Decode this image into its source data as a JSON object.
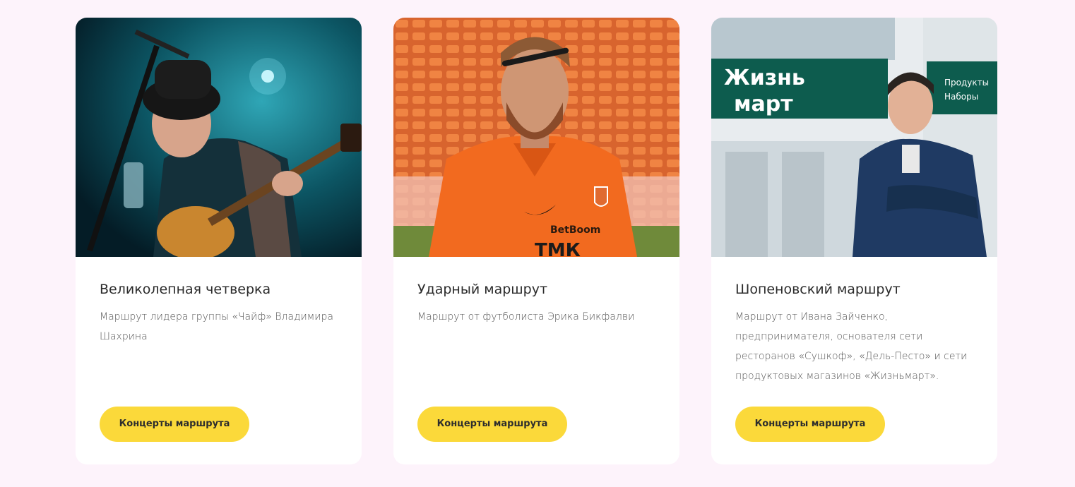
{
  "colors": {
    "page_background": "#fdf3fb",
    "card_background": "#ffffff",
    "button_background": "#fbd93a"
  },
  "cards": [
    {
      "title": "Великолепная четверка",
      "description": "Маршрут лидера группы «Чайф» Владимира Шахрина",
      "button_label": "Концерты маршрута",
      "photo_alt": "Musician with hat playing guitar on stage"
    },
    {
      "title": "Ударный маршрут",
      "description": "Маршрут от футболиста Эрика Бикфалви",
      "button_label": "Концерты маршрута",
      "photo_alt": "Football player in orange jersey at stadium",
      "photo_text": {
        "sponsor": "BetBoom",
        "jersey_lower": "ТМК"
      }
    },
    {
      "title": "Шопеновский маршрут",
      "description": "Маршрут от Ивана Зайченко, предпринимателя, основателя сети ресторанов «Сушкоф», «Дель-Песто» и сети продуктовых магазинов «Жизньмарт».",
      "button_label": "Концерты маршрута",
      "photo_alt": "Man with crossed arms in front of a store",
      "photo_text": {
        "store_line1": "Жизнь",
        "store_line2": "март",
        "sign_line1": "Продукты",
        "sign_line2": "Наборы"
      }
    }
  ]
}
